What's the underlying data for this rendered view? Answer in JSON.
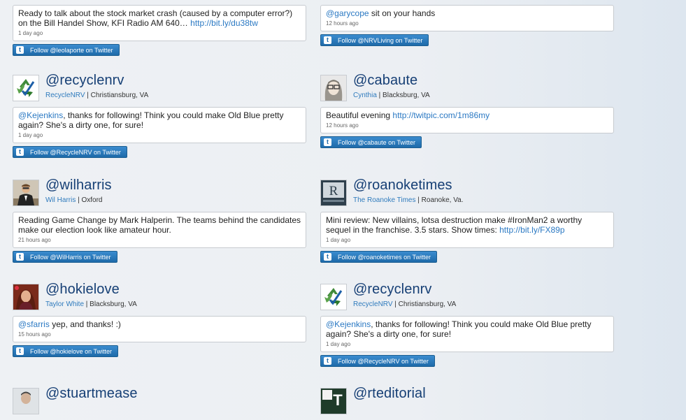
{
  "left": [
    {
      "text_pre": "Ready to talk about the stock market crash (caused by a computer error?) on the Bill Handel Show, KFI Radio AM 640… ",
      "link": "http://bit.ly/du38tw",
      "time": "1 day ago",
      "follow": "Follow @leolaporte on Twitter"
    },
    {
      "handle": "@recyclenrv",
      "name": "RecycleNRV",
      "location": " | Christiansburg, VA",
      "mention": "@Kejenkins",
      "text": ", thanks for following! Think you could make Old Blue pretty again? She's a dirty one, for sure!",
      "time": "1 day ago",
      "follow": "Follow @RecycleNRV on Twitter"
    },
    {
      "handle": "@wilharris",
      "name": "Wil Harris",
      "location": " | Oxford",
      "text": "Reading Game Change by Mark Halperin. The teams behind the candidates make our election look like amateur hour.",
      "time": "21 hours ago",
      "follow": "Follow @WilHarris on Twitter"
    },
    {
      "handle": "@hokielove",
      "name": "Taylor White",
      "location": " | Blacksburg, VA",
      "mention": "@sfarris",
      "text": " yep, and thanks! :)",
      "time": "15 hours ago",
      "follow": "Follow @hokielove on Twitter"
    },
    {
      "handle": "@stuartmease"
    }
  ],
  "right": [
    {
      "mention": "@garycope",
      "text": " sit on your hands",
      "time": "12 hours ago",
      "follow": "Follow @NRVLiving on Twitter"
    },
    {
      "handle": "@cabaute",
      "name": "Cynthia",
      "location": " | Blacksburg, VA",
      "text_pre": "Beautiful evening ",
      "link": "http://twitpic.com/1m86my",
      "time": "12 hours ago",
      "follow": "Follow @cabaute on Twitter"
    },
    {
      "handle": "@roanoketimes",
      "name": "The Roanoke Times",
      "location": " | Roanoke, Va.",
      "text_pre": "Mini review: New villains, lotsa destruction make #IronMan2 a worthy sequel in the franchise. 3.5 stars. Show times: ",
      "link": "http://bit.ly/FX89p",
      "time": "1 day ago",
      "follow": "Follow @roanoketimes on Twitter"
    },
    {
      "handle": "@recyclenrv",
      "name": "RecycleNRV",
      "location": " | Christiansburg, VA",
      "mention": "@Kejenkins",
      "text": ", thanks for following! Think you could make Old Blue pretty again? She's a dirty one, for sure!",
      "time": "1 day ago",
      "follow": "Follow @RecycleNRV on Twitter"
    },
    {
      "handle": "@rteditorial"
    }
  ],
  "icons": {
    "twitter_bird": "t",
    "roanoke_logo": "R",
    "rteditorial_logo": "T"
  },
  "colors": {
    "handle": "#163f75",
    "link": "#2b79c3",
    "follow_button": "#1e6aa9"
  }
}
